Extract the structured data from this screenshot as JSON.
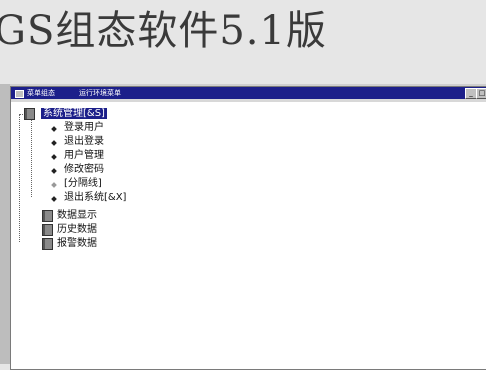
{
  "slide": {
    "title": "GS组态软件5.1版"
  },
  "window": {
    "title_left": "菜单组态",
    "title_right": "运行环境菜单",
    "buttons": {
      "minimize": "_",
      "maximize": "□"
    }
  },
  "tree": {
    "roots": [
      {
        "label": "系统管理",
        "shortcut": "[&S]",
        "selected": true
      },
      {
        "label": "数据显示"
      },
      {
        "label": "历史数据"
      },
      {
        "label": "报警数据"
      }
    ],
    "children": [
      {
        "label": "登录用户"
      },
      {
        "label": "退出登录"
      },
      {
        "label": "用户管理"
      },
      {
        "label": "修改密码"
      },
      {
        "label": "[分隔线]",
        "separator": true
      },
      {
        "label": "退出系统",
        "shortcut": "[&X]"
      }
    ]
  },
  "colors": {
    "titlebar": "#1c1f8a",
    "selection": "#1c1f8a"
  }
}
